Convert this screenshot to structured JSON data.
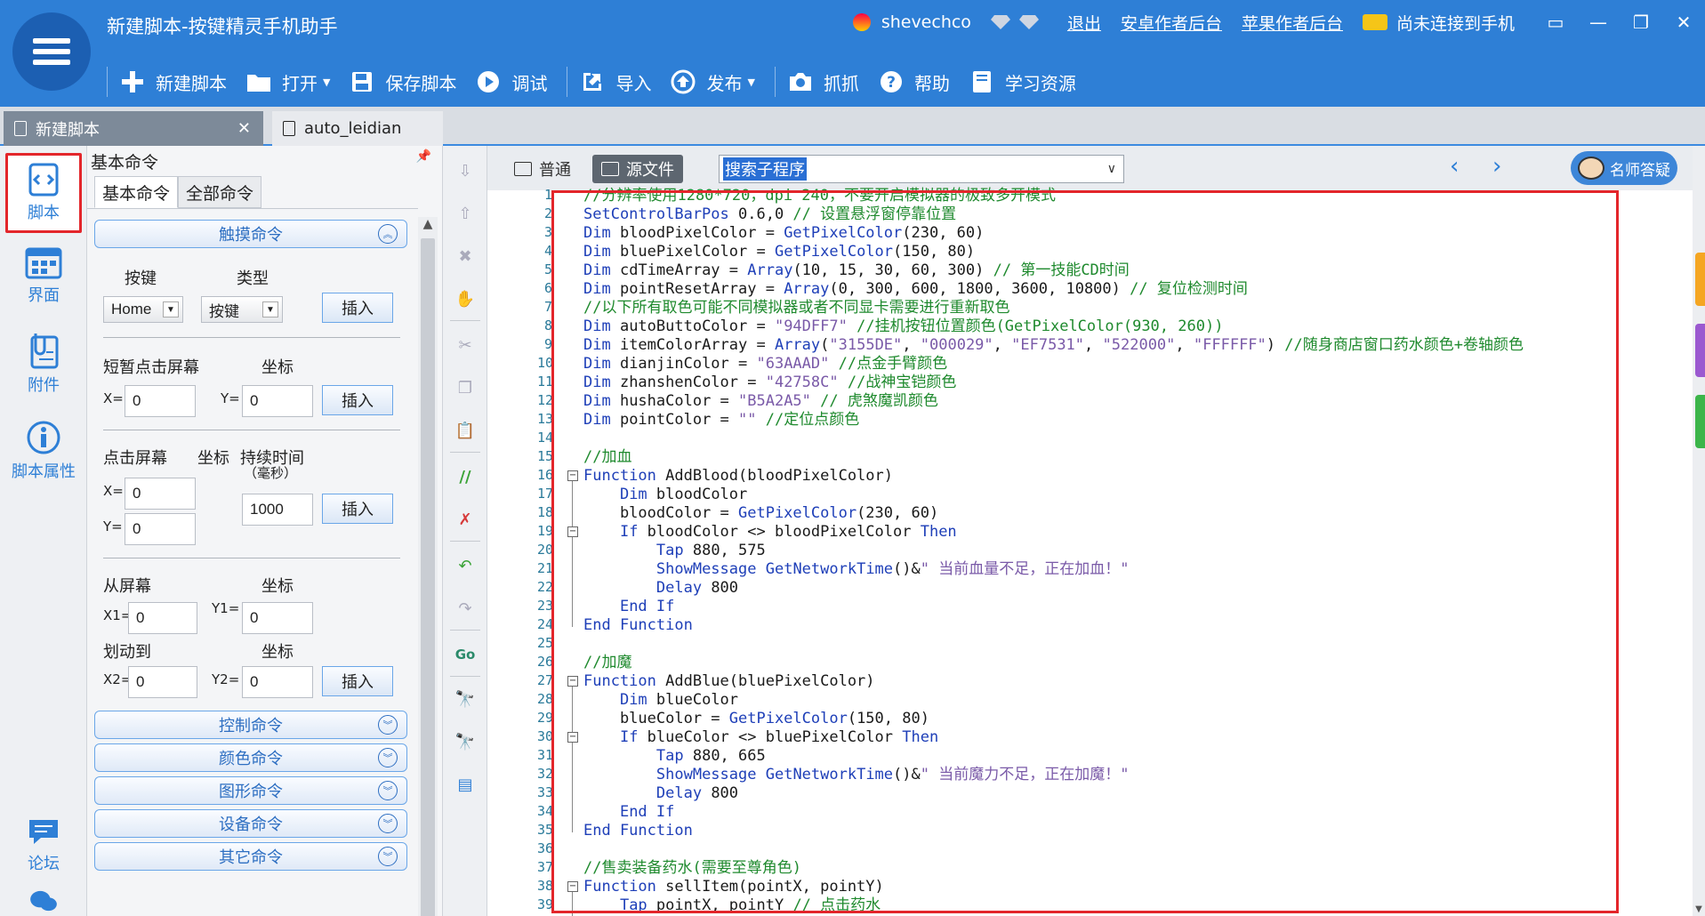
{
  "app": {
    "title": "新建脚本-按键精灵手机助手"
  },
  "titlebar": {
    "username": "shevechco",
    "logout": "退出",
    "android_backend": "安卓作者后台",
    "ios_backend": "苹果作者后台",
    "connection_status": "尚未连接到手机"
  },
  "toolbar": {
    "new_script": "新建脚本",
    "open": "打开",
    "save": "保存脚本",
    "debug": "调试",
    "import": "导入",
    "publish": "发布",
    "capture": "抓抓",
    "help": "帮助",
    "learning": "学习资源"
  },
  "doc_tabs": [
    {
      "label": "新建脚本"
    },
    {
      "label": "auto_leidian"
    }
  ],
  "left_rail": [
    {
      "label": "脚本"
    },
    {
      "label": "界面"
    },
    {
      "label": "附件"
    },
    {
      "label": "脚本属性"
    },
    {
      "label": "论坛"
    }
  ],
  "cmd_panel": {
    "title": "基本命令",
    "tabs": [
      "基本命令",
      "全部命令"
    ],
    "touch_section": "触摸命令",
    "key_label": "按键",
    "type_label": "类型",
    "key_value": "Home",
    "type_value": "按键",
    "insert": "插入",
    "short_tap_label": "短暂点击屏幕",
    "coord_label": "坐标",
    "x_eq": "X=",
    "y_eq": "Y=",
    "x1_eq": "X1=",
    "y1_eq": "Y1=",
    "x2_eq": "X2=",
    "y2_eq": "Y2=",
    "tap_label": "点击屏幕",
    "duration_label": "持续时间",
    "duration_unit": "（毫秒）",
    "duration_value": "1000",
    "zero": "0",
    "from_screen": "从屏幕",
    "swipe_to": "划动到",
    "sections": [
      "控制命令",
      "颜色命令",
      "图形命令",
      "设备命令",
      "其它命令"
    ]
  },
  "editor_bar": {
    "mode_normal": "普通",
    "mode_source": "源文件",
    "search_placeholder": "搜索子程序",
    "teacher": "名师答疑"
  },
  "code_lines": [
    {
      "n": "1",
      "t": "//分辨率使用1280*720，dpi 240，不要开启模拟器的极致多开模式"
    },
    {
      "n": "2",
      "t": "SetControlBarPos 0.6,0 // 设置悬浮窗停靠位置"
    },
    {
      "n": "3",
      "t": "Dim bloodPixelColor = GetPixelColor(230, 60)"
    },
    {
      "n": "4",
      "t": "Dim bluePixelColor = GetPixelColor(150, 80)"
    },
    {
      "n": "5",
      "t": "Dim cdTimeArray = Array(10, 15, 30, 60, 300) // 第一技能CD时间"
    },
    {
      "n": "6",
      "t": "Dim pointResetArray = Array(0, 300, 600, 1800, 3600, 10800) // 复位检测时间"
    },
    {
      "n": "7",
      "t": "//以下所有取色可能不同模拟器或者不同显卡需要进行重新取色"
    },
    {
      "n": "8",
      "t": "Dim autoButtoColor = \"94DFF7\" //挂机按钮位置颜色(GetPixelColor(930, 260))"
    },
    {
      "n": "9",
      "t": "Dim itemColorArray = Array(\"3155DE\", \"000029\", \"EF7531\", \"522000\", \"FFFFFF\") //随身商店窗口药水颜色+卷轴颜色"
    },
    {
      "n": "10",
      "t": "Dim dianjinColor = \"63AAAD\" //点金手臂颜色"
    },
    {
      "n": "11",
      "t": "Dim zhanshenColor = \"42758C\" //战神宝铠颜色"
    },
    {
      "n": "12",
      "t": "Dim hushaColor = \"B5A2A5\" // 虎煞魔凯颜色"
    },
    {
      "n": "13",
      "t": "Dim pointColor = \"\" //定位点颜色"
    },
    {
      "n": "14",
      "t": ""
    },
    {
      "n": "15",
      "t": "//加血"
    },
    {
      "n": "16",
      "t": "Function AddBlood(bloodPixelColor)"
    },
    {
      "n": "17",
      "t": "    Dim bloodColor"
    },
    {
      "n": "18",
      "t": "    bloodColor = GetPixelColor(230, 60)"
    },
    {
      "n": "19",
      "t": "    If bloodColor <> bloodPixelColor Then"
    },
    {
      "n": "20",
      "t": "        Tap 880, 575"
    },
    {
      "n": "21",
      "t": "        ShowMessage GetNetworkTime()&\" 当前血量不足，正在加血！\""
    },
    {
      "n": "22",
      "t": "        Delay 800"
    },
    {
      "n": "23",
      "t": "    End If"
    },
    {
      "n": "24",
      "t": "End Function"
    },
    {
      "n": "25",
      "t": ""
    },
    {
      "n": "26",
      "t": "//加魔"
    },
    {
      "n": "27",
      "t": "Function AddBlue(bluePixelColor)"
    },
    {
      "n": "28",
      "t": "    Dim blueColor"
    },
    {
      "n": "29",
      "t": "    blueColor = GetPixelColor(150, 80)"
    },
    {
      "n": "30",
      "t": "    If blueColor <> bluePixelColor Then"
    },
    {
      "n": "31",
      "t": "        Tap 880, 665"
    },
    {
      "n": "32",
      "t": "        ShowMessage GetNetworkTime()&\" 当前魔力不足，正在加魔！\""
    },
    {
      "n": "33",
      "t": "        Delay 800"
    },
    {
      "n": "34",
      "t": "    End If"
    },
    {
      "n": "35",
      "t": "End Function"
    },
    {
      "n": "36",
      "t": ""
    },
    {
      "n": "37",
      "t": "//售卖装备药水(需要至尊角色)"
    },
    {
      "n": "38",
      "t": "Function sellItem(pointX, pointY)"
    },
    {
      "n": "39",
      "t": "    Tap pointX, pointY // 点击药水"
    }
  ],
  "colors": {
    "brand_blue": "#2e7fd6",
    "highlight_red": "#e3262b",
    "comment_green": "#1f8a2e",
    "keyword_blue": "#1e3fb8"
  }
}
